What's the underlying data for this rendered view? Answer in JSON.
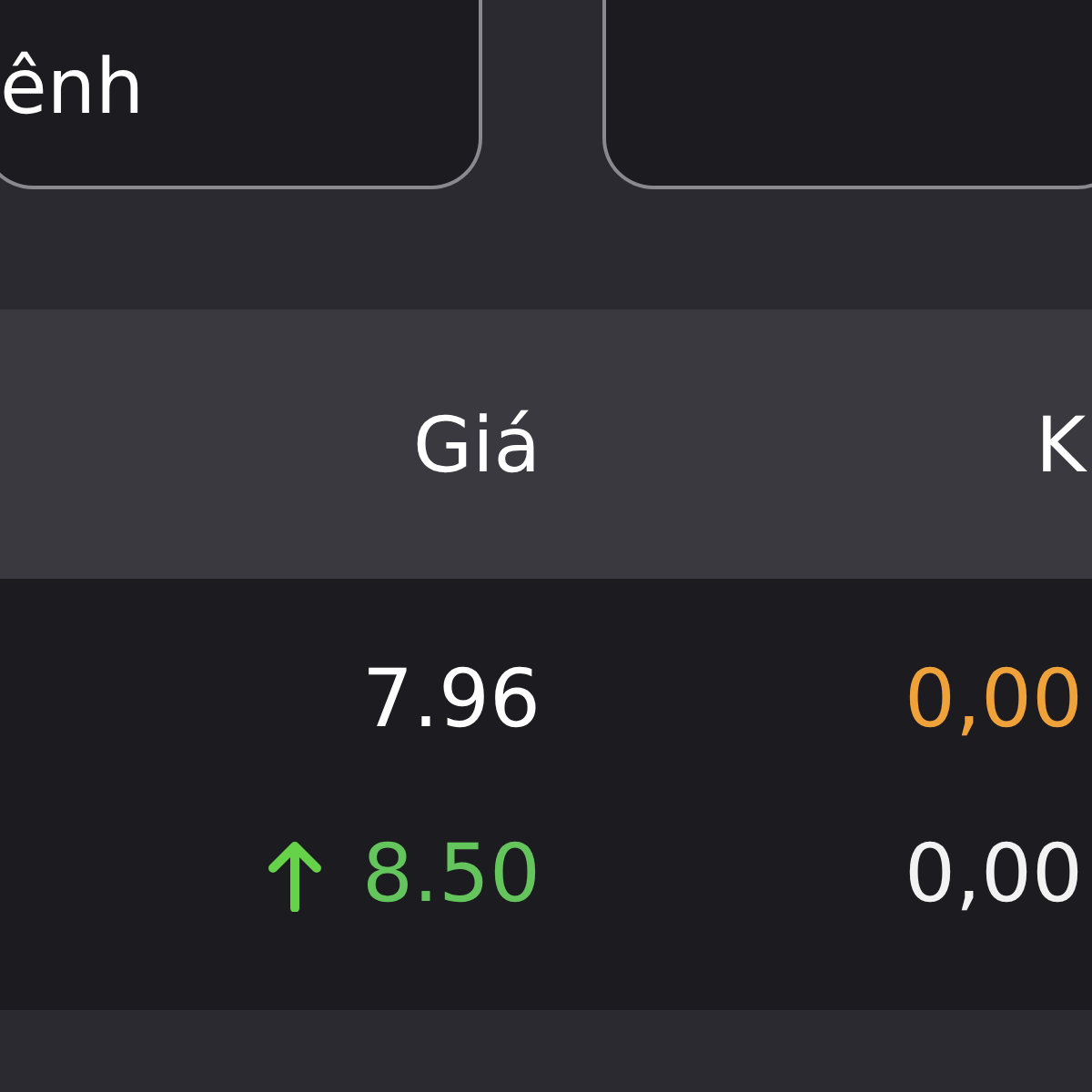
{
  "fields": [
    {
      "kind": "text",
      "label": "ênh"
    },
    {
      "kind": "blank"
    }
  ],
  "table": {
    "columns": [
      "Giá",
      "K"
    ],
    "rows": [
      {
        "kind": "plain",
        "price": "7.96",
        "column_2": "0,00",
        "color": "#f0a23a"
      },
      {
        "kind": "up",
        "price": "8.50",
        "column_2": "0,00",
        "color": "#f2f2f2"
      }
    ]
  }
}
